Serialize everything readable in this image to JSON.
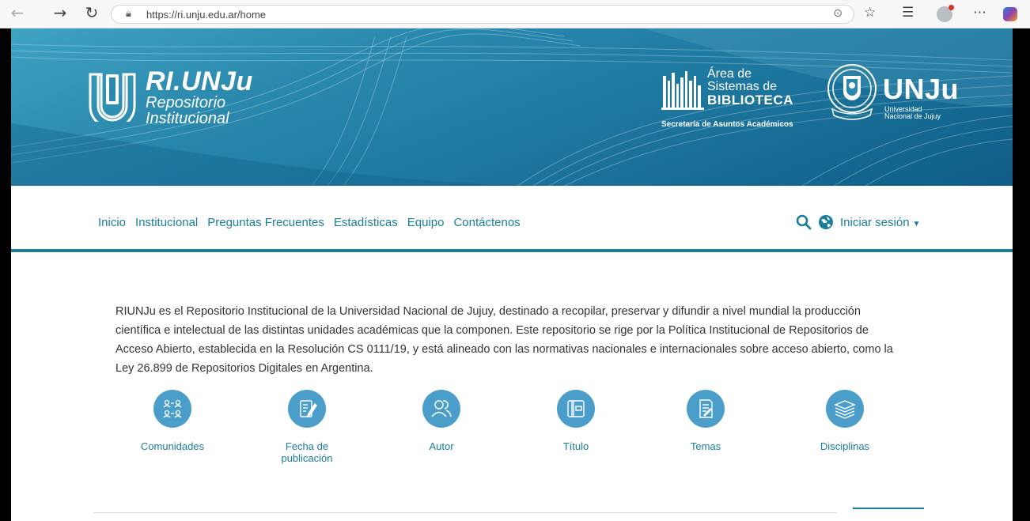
{
  "browser": {
    "url": "https://ri.unju.edu.ar/home",
    "back_icon": "arrow-left-icon",
    "forward_icon": "arrow-right-icon",
    "reload_icon": "reload-icon"
  },
  "banner": {
    "riunju": {
      "title": "RI.UNJu",
      "line1": "Repositorio",
      "line2": "Institucional"
    },
    "area": {
      "line1": "Área de",
      "line2": "Sistemas de",
      "line3": "BIBLIOTECA",
      "subtitle": "Secretaría de Asuntos Académicos"
    },
    "unju": {
      "title": "UNJu",
      "line1": "Universidad",
      "line2": "Nacional de Jujuy"
    }
  },
  "nav": {
    "items": [
      "Inicio",
      "Institucional",
      "Preguntas Frecuentes",
      "Estadísticas",
      "Equipo",
      "Contáctenos"
    ],
    "login": "Iniciar sesión"
  },
  "intro": "RIUNJu es el Repositorio Institucional de la Universidad Nacional de Jujuy, destinado a recopilar, preservar y difundir a nivel mundial la producción científica e intelectual de las distintas unidades académicas que la componen. Este repositorio se rige por la Política Institucional de Repositorios de Acceso Abierto, establecida en la Resolución CS 0111/19, y está alineado con las normativas nacionales e internacionales sobre acceso abierto, como la Ley 26.899 de Repositorios Digitales en Argentina.",
  "browse": [
    {
      "label": "Comunidades",
      "icon": "communities-icon"
    },
    {
      "label": "Fecha de publicación",
      "icon": "date-icon"
    },
    {
      "label": "Autor",
      "icon": "author-icon"
    },
    {
      "label": "Título",
      "icon": "title-icon"
    },
    {
      "label": "Temas",
      "icon": "subjects-icon"
    },
    {
      "label": "Disciplinas",
      "icon": "disciplines-icon"
    }
  ],
  "colors": {
    "accent": "#1b7d9c",
    "icon_bg": "#4a9ec9",
    "banner": "#1f7aa1"
  }
}
